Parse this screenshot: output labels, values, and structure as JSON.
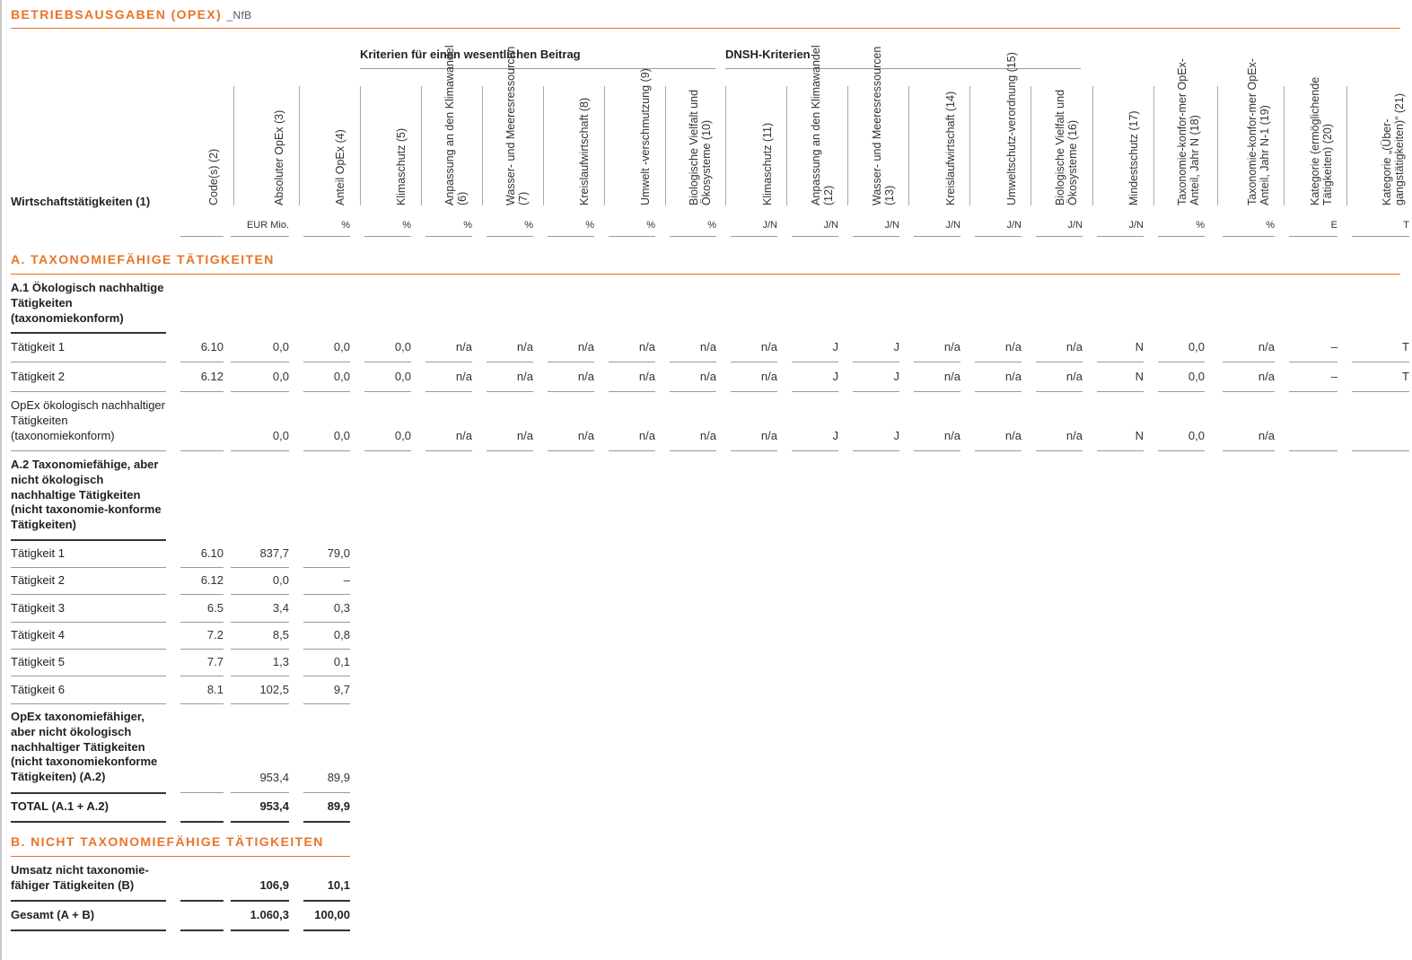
{
  "title": "BETRIEBSAUSGABEN (OPEX)",
  "title_suffix": "_NfB",
  "header": {
    "row_label": "Wirtschaftstätigkeiten (1)",
    "group_substantial": "Kriterien für einen wesentlichen Beitrag",
    "group_dnsh": "DNSH-Kriterien",
    "columns": [
      {
        "label": "Code(s) (2)",
        "unit": ""
      },
      {
        "label": "Absoluter OpEx (3)",
        "unit": "EUR Mio."
      },
      {
        "label": "Anteil OpEx (4)",
        "unit": "%"
      },
      {
        "label": "Klimaschutz (5)",
        "unit": "%"
      },
      {
        "label": "Anpassung an den Klimawandel (6)",
        "unit": "%"
      },
      {
        "label": "Wasser- und Meeresressourcen (7)",
        "unit": "%"
      },
      {
        "label": "Kreislaufwirtschaft (8)",
        "unit": "%"
      },
      {
        "label": "Umwelt -verschmutzung (9)",
        "unit": "%"
      },
      {
        "label": "Biologische Vielfalt und Ökosysteme (10)",
        "unit": "%"
      },
      {
        "label": "Klimaschutz (11)",
        "unit": "J/N"
      },
      {
        "label": "Anpassung an den Klimawandel (12)",
        "unit": "J/N"
      },
      {
        "label": "Wasser- und Meeresressourcen (13)",
        "unit": "J/N"
      },
      {
        "label": "Kreislaufwirtschaft (14)",
        "unit": "J/N"
      },
      {
        "label": "Umweltschutz-verordnung (15)",
        "unit": "J/N"
      },
      {
        "label": "Biologische Vielfalt und Ökosysteme (16)",
        "unit": "J/N"
      },
      {
        "label": "Mindestschutz (17)",
        "unit": "J/N"
      },
      {
        "label": "Taxonomie-konfor-mer OpEx-Anteil, Jahr N (18)",
        "unit": "%"
      },
      {
        "label": "Taxonomie-konfor-mer OpEx-Anteil, Jahr N-1 (19)",
        "unit": "%"
      },
      {
        "label": "Kategorie (ermöglichende Tätigkeiten) (20)",
        "unit": "E"
      },
      {
        "label": "Kategorie „(Über-gangstätigkeiten)“ (21)",
        "unit": "T"
      }
    ]
  },
  "section_a": {
    "title": "A. TAXONOMIEFÄHIGE TÄTIGKEITEN",
    "a1": {
      "heading": "A.1 Ökologisch nachhaltige Tätigkeiten (taxonomiekonform)",
      "rows": [
        {
          "label": "Tätigkeit 1",
          "values": [
            "6.10",
            "0,0",
            "0,0",
            "0,0",
            "n/a",
            "n/a",
            "n/a",
            "n/a",
            "n/a",
            "n/a",
            "J",
            "J",
            "n/a",
            "n/a",
            "n/a",
            "N",
            "0,0",
            "n/a",
            "–",
            "T"
          ]
        },
        {
          "label": "Tätigkeit 2",
          "values": [
            "6.12",
            "0,0",
            "0,0",
            "0,0",
            "n/a",
            "n/a",
            "n/a",
            "n/a",
            "n/a",
            "n/a",
            "J",
            "J",
            "n/a",
            "n/a",
            "n/a",
            "N",
            "0,0",
            "n/a",
            "–",
            "T"
          ]
        }
      ],
      "subtotal": {
        "label": "OpEx ökologisch nachhaltiger Tätigkeiten (taxonomiekonform)",
        "values": [
          "",
          "0,0",
          "0,0",
          "0,0",
          "n/a",
          "n/a",
          "n/a",
          "n/a",
          "n/a",
          "n/a",
          "J",
          "J",
          "n/a",
          "n/a",
          "n/a",
          "N",
          "0,0",
          "n/a",
          "",
          ""
        ]
      }
    },
    "a2": {
      "heading": "A.2 Taxonomiefähige, aber nicht ökologisch nachhaltige Tätigkeiten (nicht taxonomie-konforme Tätigkeiten)",
      "rows": [
        {
          "label": "Tätigkeit 1",
          "values": [
            "6.10",
            "837,7",
            "79,0"
          ]
        },
        {
          "label": "Tätigkeit 2",
          "values": [
            "6.12",
            "0,0",
            "–"
          ]
        },
        {
          "label": "Tätigkeit 3",
          "values": [
            "6.5",
            "3,4",
            "0,3"
          ]
        },
        {
          "label": "Tätigkeit 4",
          "values": [
            "7.2",
            "8,5",
            "0,8"
          ]
        },
        {
          "label": "Tätigkeit 5",
          "values": [
            "7.7",
            "1,3",
            "0,1"
          ]
        },
        {
          "label": "Tätigkeit 6",
          "values": [
            "8.1",
            "102,5",
            "9,7"
          ]
        }
      ],
      "subtotal": {
        "label": "OpEx taxonomiefähiger, aber nicht ökologisch nachhaltiger Tätigkeiten (nicht taxonomiekonforme Tätigkeiten) (A.2)",
        "values": [
          "",
          "953,4",
          "89,9"
        ]
      }
    },
    "total": {
      "label": "TOTAL (A.1 + A.2)",
      "values": [
        "",
        "953,4",
        "89,9"
      ]
    }
  },
  "section_b": {
    "title": "B. NICHT TAXONOMIEFÄHIGE TÄTIGKEITEN",
    "row": {
      "label": "Umsatz nicht taxonomie-fähiger Tätigkeiten (B)",
      "values": [
        "",
        "106,9",
        "10,1"
      ]
    },
    "grand_total": {
      "label": "Gesamt (A + B)",
      "values": [
        "",
        "1.060,3",
        "100,00"
      ]
    }
  }
}
